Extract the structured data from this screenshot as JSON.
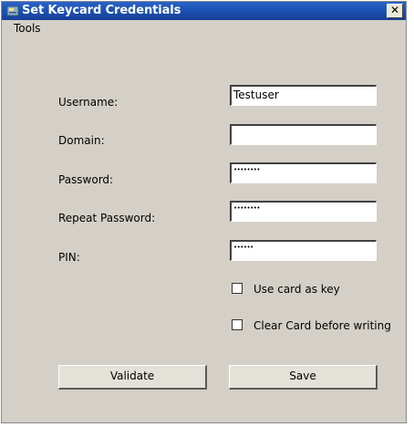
{
  "window": {
    "title": "Set Keycard Credentials",
    "close_symbol": "✕"
  },
  "menu": {
    "tools": "Tools"
  },
  "form": {
    "username_label": "Username:",
    "username_value": "Testuser",
    "domain_label": "Domain:",
    "domain_value": "",
    "password_label": "Password:",
    "password_value": "••••••••",
    "repeat_label": "Repeat Password:",
    "repeat_value": "••••••••",
    "pin_label": "PIN:",
    "pin_value": "••••••"
  },
  "options": {
    "use_card_as_key": "Use card as key",
    "use_card_checked": false,
    "clear_card": "Clear Card before writing",
    "clear_card_checked": false
  },
  "buttons": {
    "validate": "Validate",
    "save": "Save"
  },
  "icons": {
    "app": "keycard-icon",
    "close": "close-icon"
  }
}
